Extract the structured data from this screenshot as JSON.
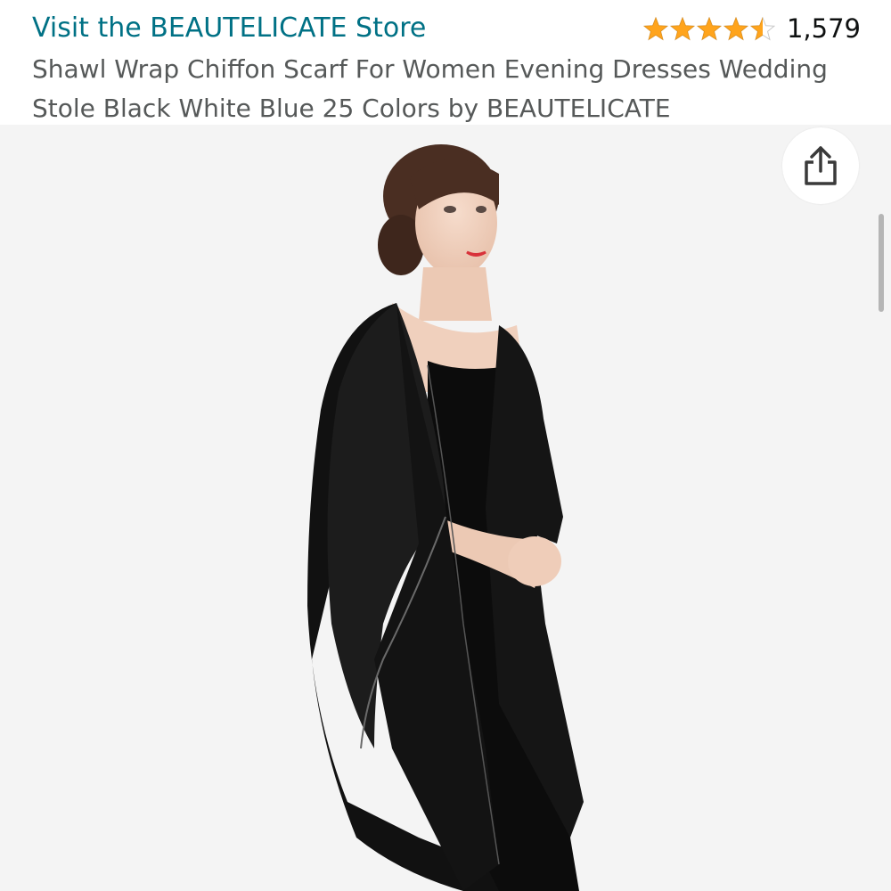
{
  "header": {
    "store_link": "Visit the BEAUTELICATE Store",
    "rating_value": 4.5,
    "rating_max": 5,
    "review_count": "1,579",
    "title": "Shawl Wrap Chiffon Scarf For Women Evening Dresses Wedding Stole Black White Blue 25 Colors by BEAUTELICATE"
  },
  "share": {
    "icon": "share-icon"
  },
  "colors": {
    "link": "#007185",
    "star": "#FFA41C",
    "title": "#565959",
    "image_background": "#f4f4f4"
  }
}
